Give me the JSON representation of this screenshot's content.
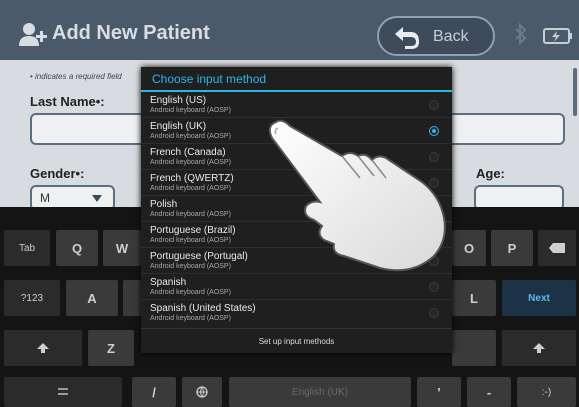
{
  "header": {
    "title": "Add New Patient",
    "back_label": "Back",
    "icons": [
      "add-user-icon",
      "back-arrow-icon",
      "bluetooth-icon",
      "battery-charging-icon"
    ]
  },
  "form": {
    "required_note": "• indicates a required field",
    "last_name_label": "Last Name•:",
    "gender_label": "Gender•:",
    "gender_value": "M",
    "age_label": "Age:"
  },
  "dialog": {
    "title": "Choose input method",
    "options": [
      {
        "name": "English (US)",
        "sub": "Android keyboard (AOSP)",
        "selected": false
      },
      {
        "name": "English (UK)",
        "sub": "Android keyboard (AOSP)",
        "selected": true
      },
      {
        "name": "French (Canada)",
        "sub": "Android keyboard (AOSP)",
        "selected": false
      },
      {
        "name": "French (QWERTZ)",
        "sub": "Android keyboard (AOSP)",
        "selected": false
      },
      {
        "name": "Polish",
        "sub": "Android keyboard (AOSP)",
        "selected": false
      },
      {
        "name": "Portuguese (Brazil)",
        "sub": "Android keyboard (AOSP)",
        "selected": false
      },
      {
        "name": "Portuguese (Portugal)",
        "sub": "Android keyboard (AOSP)",
        "selected": false
      },
      {
        "name": "Spanish",
        "sub": "Android keyboard (AOSP)",
        "selected": false
      },
      {
        "name": "Spanish (United States)",
        "sub": "Android keyboard (AOSP)",
        "selected": false
      }
    ],
    "setup_label": "Set up input methods"
  },
  "keyboard": {
    "tab": "Tab",
    "q": "Q",
    "w": "W",
    "o": "O",
    "p": "P",
    "sym": "?123",
    "a": "A",
    "l": "L",
    "next": "Next",
    "z": "Z",
    "slash": "/",
    "space": "English (UK)",
    "apostrophe": "'",
    "dash": "-",
    "smiley": ":-)"
  },
  "colors": {
    "accent": "#2fb6e6",
    "header": "#4b5a6b",
    "form_bg": "#d8dbe0"
  }
}
